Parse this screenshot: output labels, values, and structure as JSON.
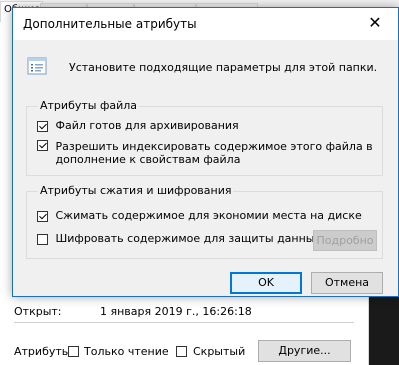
{
  "background_window": {
    "tab_first_label": "Общие",
    "opened_label": "Открыт:",
    "opened_value": "1 января 2019 г., 16:26:18",
    "attributes_label": "Атрибуты:",
    "readonly_label": "Только чтение",
    "hidden_label": "Скрытый",
    "other_button": "Другие..."
  },
  "dialog": {
    "title": "Дополнительные атрибуты",
    "close_glyph": "✕",
    "info_text": "Установите подходящие параметры для этой папки.",
    "file_group": {
      "title": "Атрибуты файла",
      "archive_label": "Файл готов для архивирования",
      "archive_checked": true,
      "index_label_line1": "Разрешить индексировать содержимое этого файла в",
      "index_label_line2": "дополнение к свойствам файла",
      "index_checked": true
    },
    "compress_group": {
      "title": "Атрибуты сжатия и шифрования",
      "compress_label": "Сжимать содержимое для экономии места на диске",
      "compress_checked": true,
      "encrypt_label": "Шифровать содержимое для защиты данных",
      "encrypt_checked": false,
      "details_button": "Подробно"
    },
    "ok_button": "OK",
    "cancel_button": "Отмена"
  },
  "colors": {
    "accent": "#0078d7",
    "dialog_bg": "#f0f0f0",
    "dark_strip": "#1a1a1a"
  }
}
